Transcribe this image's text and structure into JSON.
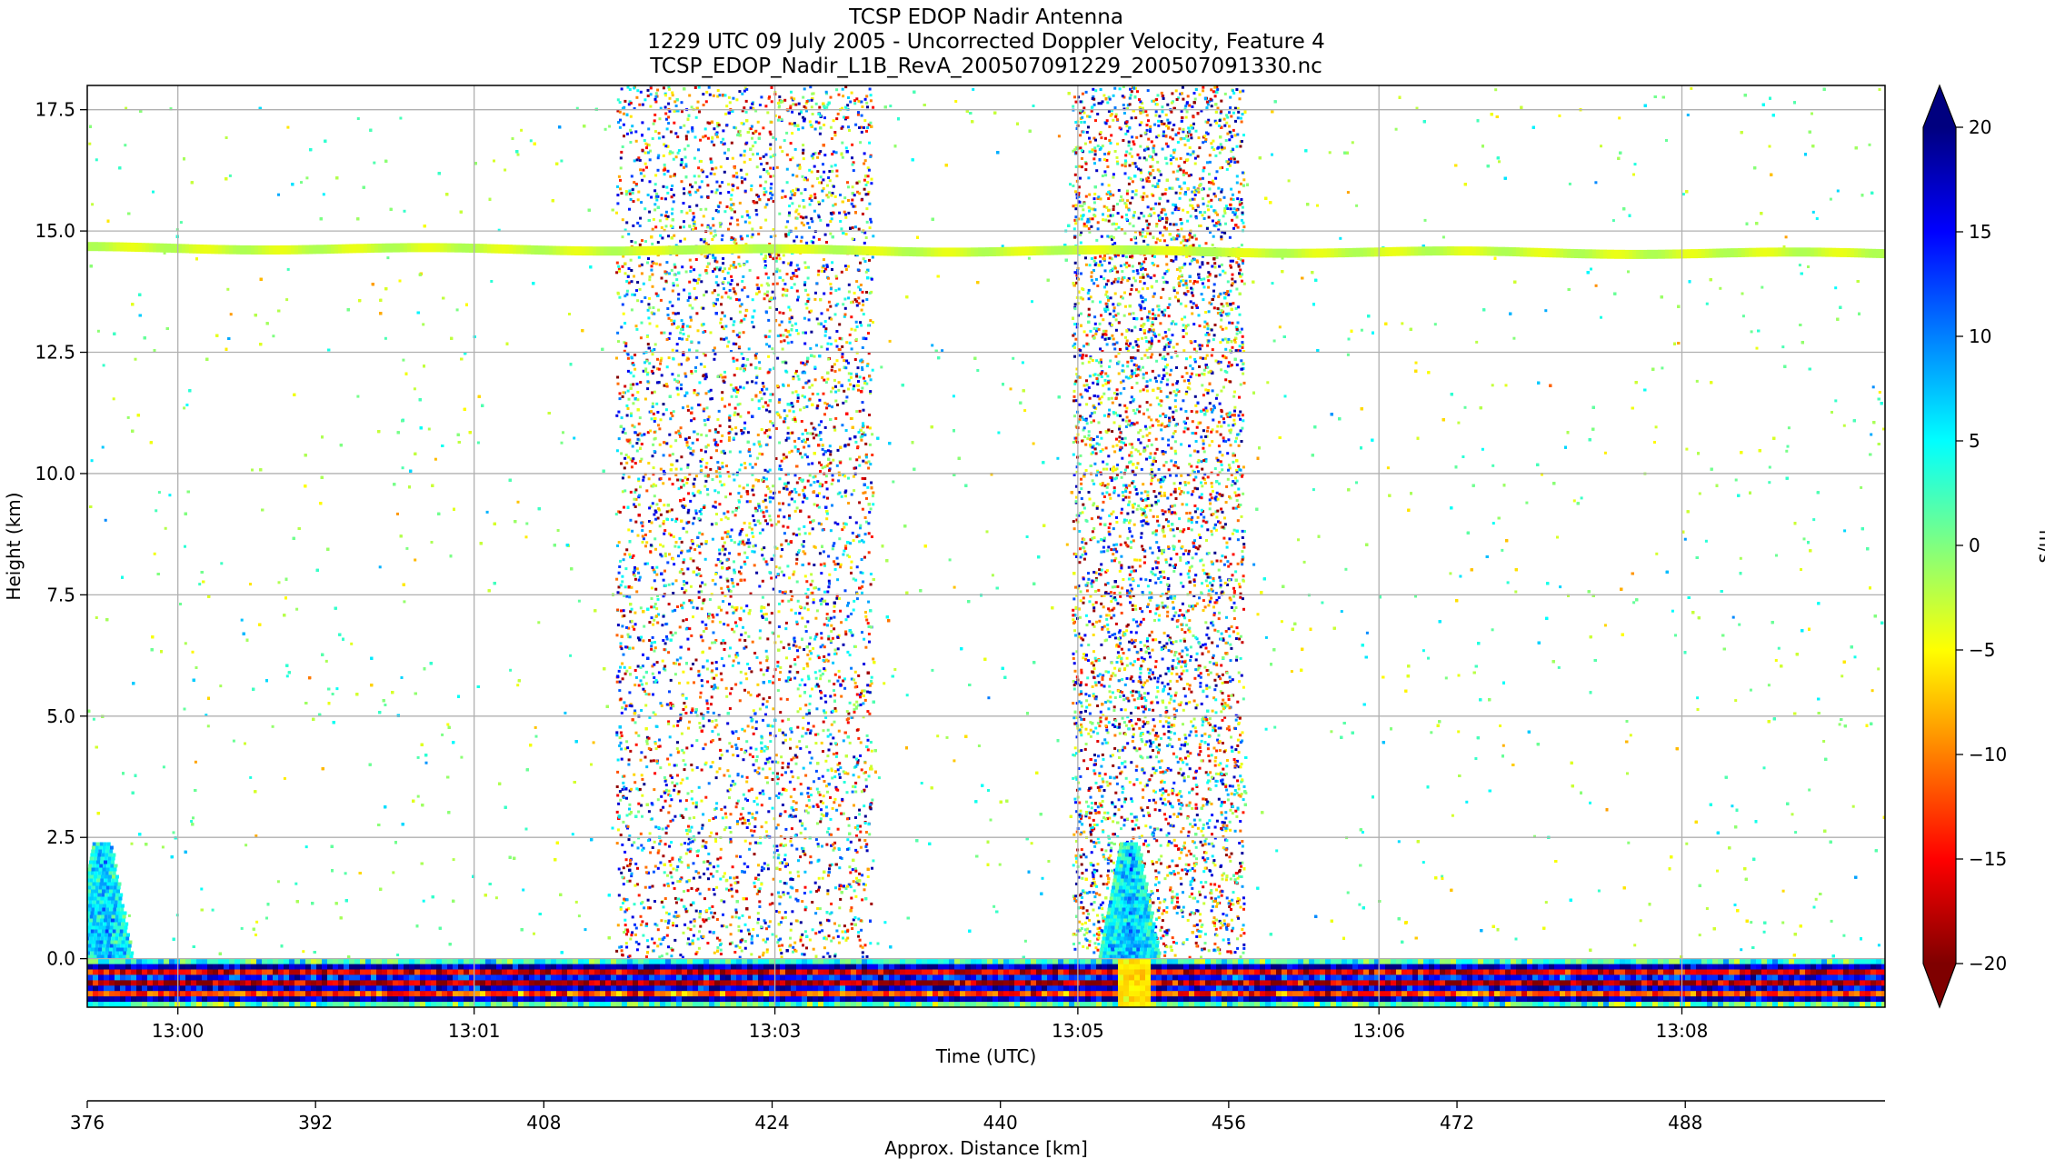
{
  "chart_data": {
    "type": "heatmap",
    "title": [
      "TCSP EDOP Nadir Antenna",
      "1229 UTC 09 July 2005 - Uncorrected Doppler Velocity, Feature 4",
      "TCSP_EDOP_Nadir_L1B_RevA_200507091229_200507091330.nc"
    ],
    "xlabel": "Time (UTC)",
    "ylabel": "Height (km)",
    "x_ticks": [
      "13:00",
      "13:01",
      "13:03",
      "13:05",
      "13:06",
      "13:08"
    ],
    "y_ticks": [
      "17.5",
      "15.0",
      "12.5",
      "10.0",
      "7.5",
      "5.0",
      "2.5",
      "0.0"
    ],
    "ylim": [
      -1.0,
      18.0
    ],
    "grid": true,
    "secondary_xaxis": {
      "label": "Approx. Distance [km]",
      "ticks": [
        "376",
        "392",
        "408",
        "424",
        "440",
        "456",
        "472",
        "488"
      ],
      "range": [
        376,
        502
      ]
    },
    "colorbar": {
      "label": "m/s",
      "ticks": [
        "20",
        "15",
        "10",
        "5",
        "0",
        "−5",
        "−10",
        "−15",
        "−20"
      ],
      "range": [
        -20,
        20
      ],
      "extend": "both",
      "colormap": "jet_r",
      "colors": [
        "#7f0000",
        "#ff0000",
        "#ff8000",
        "#ffff00",
        "#80ff80",
        "#00ffff",
        "#0080ff",
        "#0000ff",
        "#00007f"
      ]
    },
    "features": {
      "tropopause_layer": {
        "height_km": 14.5,
        "velocity_ms": -3
      },
      "convective_cells": [
        {
          "distance_km": 377,
          "top_km": 2.4,
          "velocity_ms": 8
        },
        {
          "distance_km": 449,
          "top_km": 2.4,
          "velocity_ms": 8
        }
      ],
      "surface_band_km": [
        -1.0,
        0.0
      ]
    }
  }
}
